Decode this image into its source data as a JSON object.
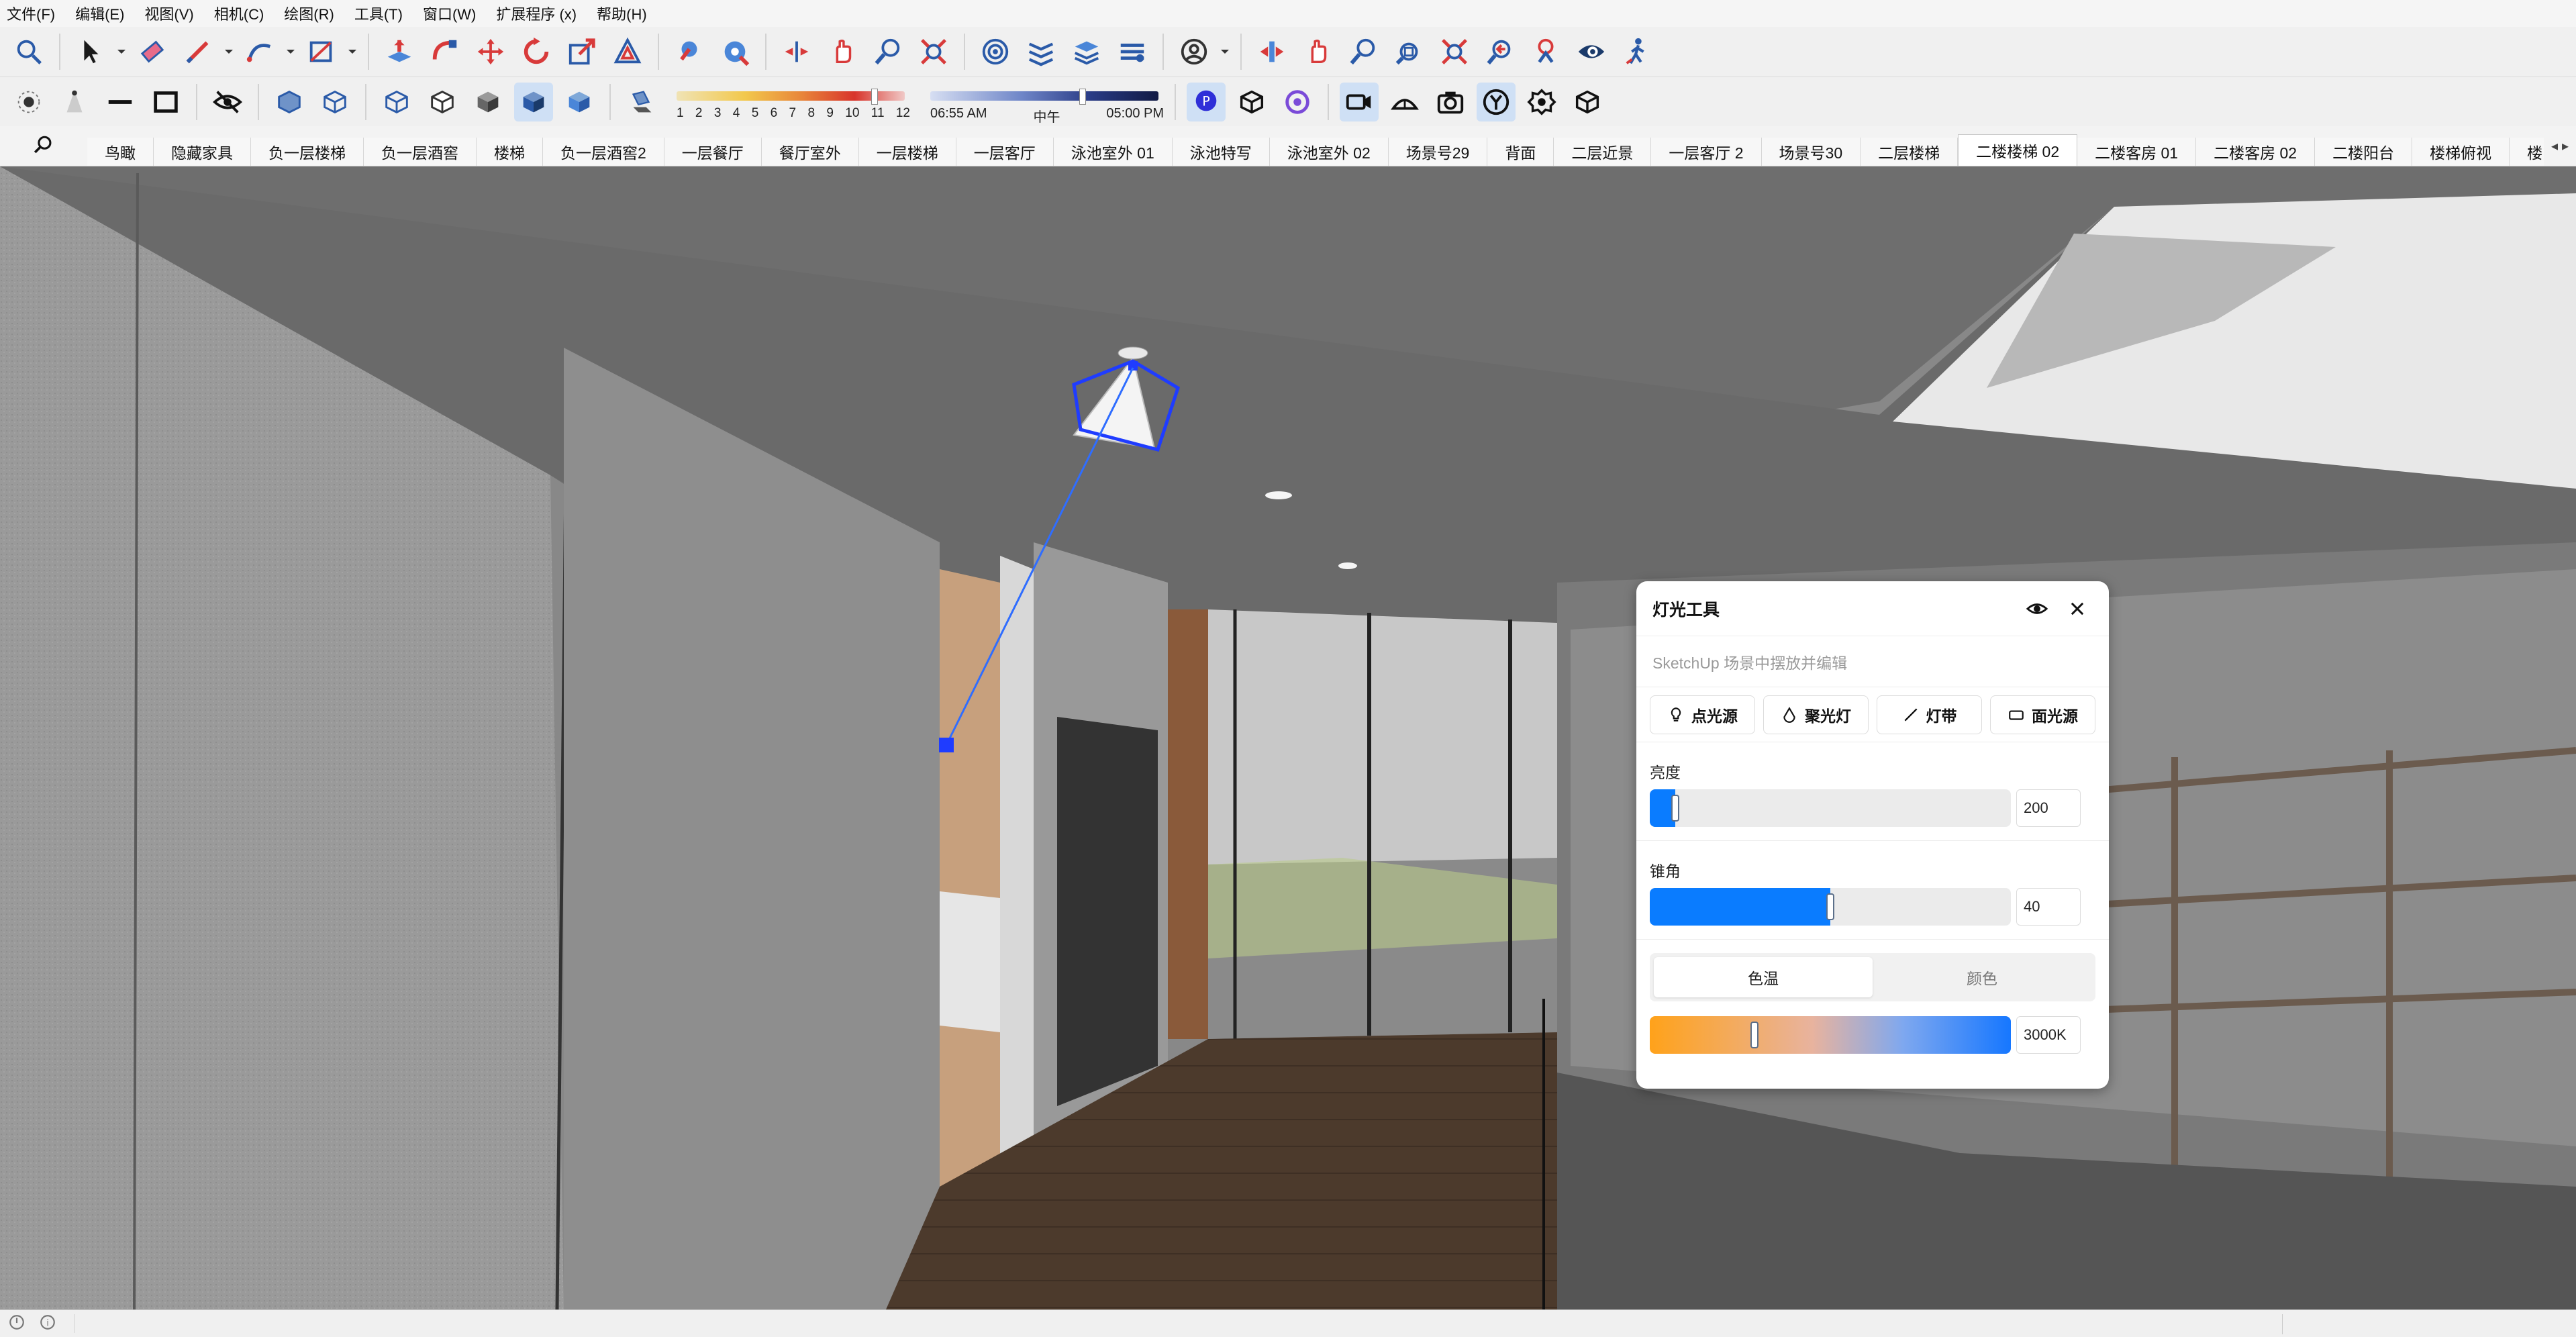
{
  "menu": [
    "文件(F)",
    "编辑(E)",
    "视图(V)",
    "相机(C)",
    "绘图(R)",
    "工具(T)",
    "窗口(W)",
    "扩展程序 (x)",
    "帮助(H)"
  ],
  "shadow": {
    "month_labels": [
      "1",
      "2",
      "3",
      "4",
      "5",
      "6",
      "7",
      "8",
      "9",
      "10",
      "11",
      "12"
    ],
    "time_start": "06:55 AM",
    "time_mid": "中午",
    "time_end": "05:00 PM"
  },
  "scenes": [
    "鸟瞰",
    "隐藏家具",
    "负一层楼梯",
    "负一层酒窖",
    "楼梯",
    "负一层酒窖2",
    "一层餐厅",
    "餐厅室外",
    "一层楼梯",
    "一层客厅",
    "泳池室外 01",
    "泳池特写",
    "泳池室外 02",
    "场景号29",
    "背面",
    "二层近景",
    "一层客厅 2",
    "场景号30",
    "二层楼梯",
    "二楼楼梯 02",
    "二楼客房 01",
    "二楼客房 02",
    "二楼阳台",
    "楼梯俯视",
    "楼"
  ],
  "active_scene": "二楼楼梯 02",
  "light_panel": {
    "title": "灯光工具",
    "subtitle": "SketchUp 场景中摆放并编辑",
    "types": [
      "点光源",
      "聚光灯",
      "灯带",
      "面光源"
    ],
    "brightness": {
      "label": "亮度",
      "value": "200",
      "fill_fraction": 0.07
    },
    "cone_angle": {
      "label": "锥角",
      "value": "40",
      "fill_fraction": 0.5
    },
    "color_tabs": [
      "色温",
      "颜色"
    ],
    "active_color_tab": "色温",
    "color_temp": {
      "value": "3000K",
      "position_fraction": 0.29
    }
  },
  "colors": {
    "accent": "#0a7cff",
    "selection_blue": "#1f3cff"
  },
  "icons": {
    "toolbar1": [
      "search-icon",
      "select-icon",
      "eraser-icon",
      "pencil-icon",
      "arc-icon",
      "rectangle-icon",
      "push-pull-icon",
      "follow-me-icon",
      "move-icon",
      "rotate-icon",
      "scale-icon",
      "offset-icon",
      "paint-bucket-icon",
      "tape-measure-icon",
      "orbit-icon",
      "pan-icon",
      "zoom-icon",
      "zoom-extents-icon",
      "3d-warehouse-icon",
      "extension-warehouse-icon",
      "layout-icon",
      "account-icon",
      "section-plane-icon",
      "hand-icon",
      "zoom-window-icon",
      "previous-view-icon",
      "position-camera-icon",
      "look-around-icon",
      "walk-icon"
    ],
    "toolbar2": [
      "axes-icon",
      "guide-icon",
      "line-icon",
      "rectangle-icon",
      "hide-icon",
      "xray-icon",
      "back-edges-icon",
      "wireframe-icon",
      "hidden-line-icon",
      "shaded-icon",
      "shaded-textures-icon",
      "monochrome-icon",
      "shadow-icon",
      "plugin-beta-icon",
      "box-icon",
      "orbit-plugin-icon",
      "camera-icon",
      "light-icon",
      "photo-icon",
      "y-icon",
      "component-icon",
      "cube-icon"
    ]
  }
}
